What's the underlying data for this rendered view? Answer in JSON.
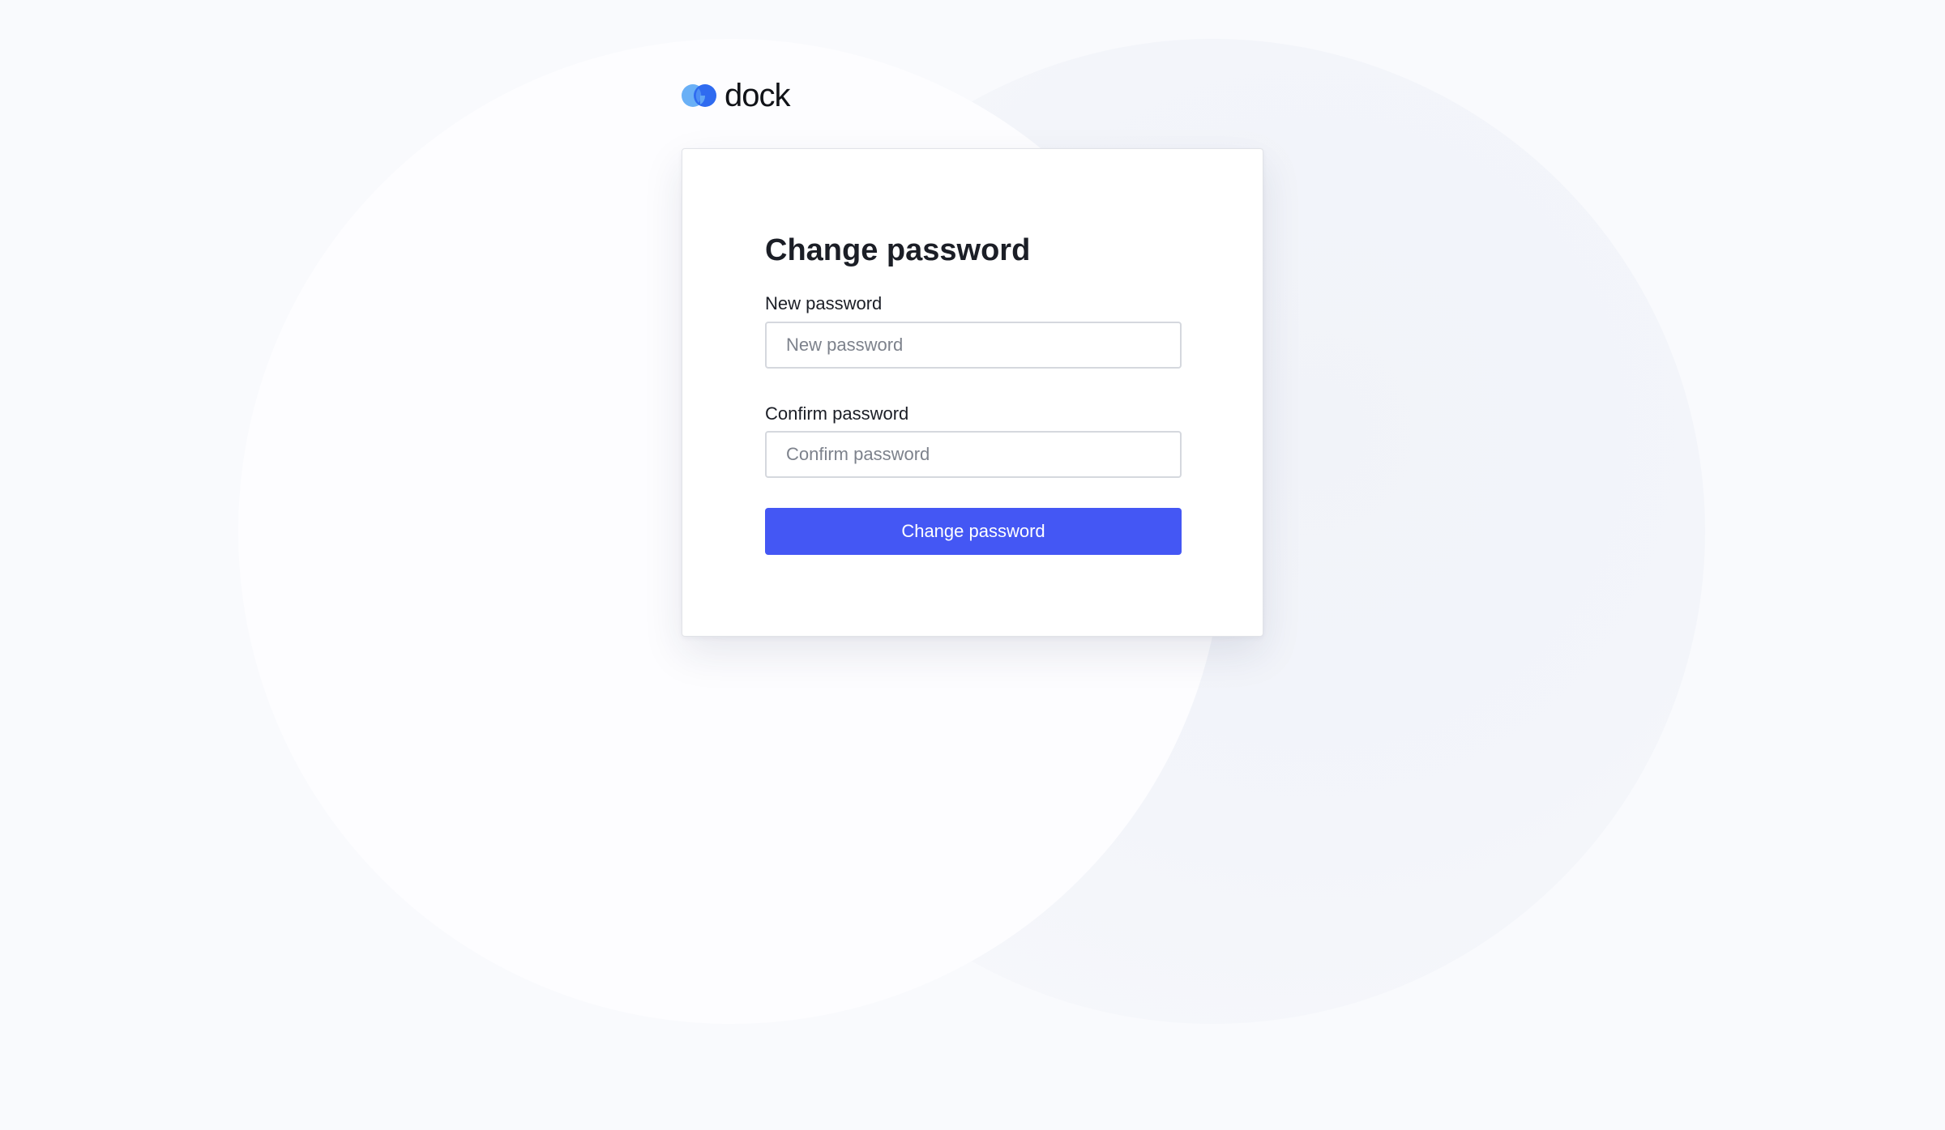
{
  "brand": {
    "name": "dock",
    "icon": "dock-logo-icon",
    "colors": {
      "primary": "#2f6bf0",
      "secondary": "#6ab0f6"
    }
  },
  "form": {
    "title": "Change password",
    "new_password": {
      "label": "New password",
      "placeholder": "New password",
      "value": ""
    },
    "confirm_password": {
      "label": "Confirm password",
      "placeholder": "Confirm password",
      "value": ""
    },
    "submit_label": "Change password"
  },
  "theme": {
    "accent": "#4457f4",
    "background": "#f9fafd"
  }
}
